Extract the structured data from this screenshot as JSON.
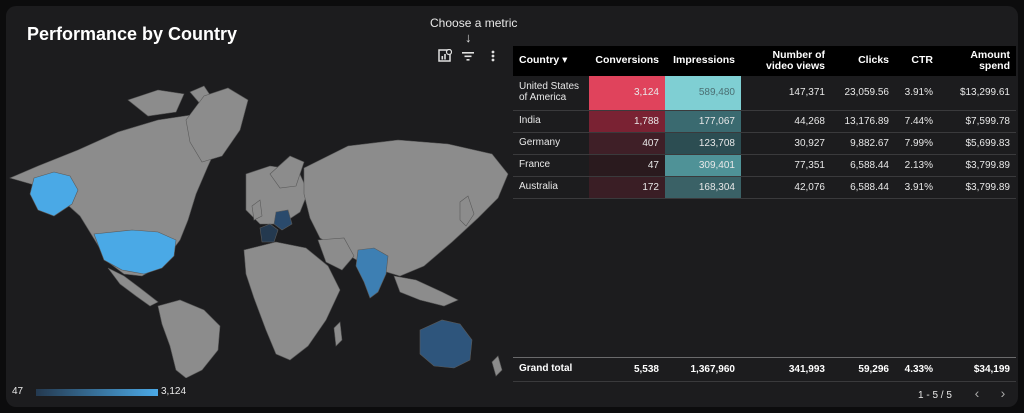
{
  "title": "Performance by Country",
  "metric_hint": "Choose a metric",
  "arrow_glyph": "↓",
  "toolbar": {
    "chart_icon": "chart-settings-icon",
    "filter_icon": "filter-icon",
    "more_icon": "more-vert-icon"
  },
  "legend": {
    "min": "47",
    "max": "3,124",
    "color_low": "#24394f",
    "color_high": "#4ba9e6"
  },
  "table": {
    "headers": [
      "Country",
      "Conversions",
      "Impressions",
      "Number of video views",
      "Clicks",
      "CTR",
      "Amount spend"
    ],
    "sort_glyph": "▾",
    "rows": [
      {
        "country": "United States of America",
        "conversions": "3,124",
        "impressions": "589,480",
        "video_views": "147,371",
        "clicks": "23,059.56",
        "ctr": "3.91%",
        "spend": "$13,299.61"
      },
      {
        "country": "India",
        "conversions": "1,788",
        "impressions": "177,067",
        "video_views": "44,268",
        "clicks": "13,176.89",
        "ctr": "7.44%",
        "spend": "$7,599.78"
      },
      {
        "country": "Germany",
        "conversions": "407",
        "impressions": "123,708",
        "video_views": "30,927",
        "clicks": "9,882.67",
        "ctr": "7.99%",
        "spend": "$5,699.83"
      },
      {
        "country": "France",
        "conversions": "47",
        "impressions": "309,401",
        "video_views": "77,351",
        "clicks": "6,588.44",
        "ctr": "2.13%",
        "spend": "$3,799.89"
      },
      {
        "country": "Australia",
        "conversions": "172",
        "impressions": "168,304",
        "video_views": "42,076",
        "clicks": "6,588.44",
        "ctr": "3.91%",
        "spend": "$3,799.89"
      }
    ],
    "conversion_colors": [
      "#e0435c",
      "#7a2233",
      "#3f1f27",
      "#2a1a1e",
      "#3a1e25"
    ],
    "impression_colors": [
      "#7fcfd3",
      "#3a6a70",
      "#2c4d52",
      "#4f9297",
      "#3a6166"
    ],
    "impression_text_colors": [
      "#4b6f73",
      "#e8e8e8",
      "#e8e8e8",
      "#e8e8e8",
      "#e8e8e8"
    ],
    "grand_total": {
      "label": "Grand total",
      "conversions": "5,538",
      "impressions": "1,367,960",
      "video_views": "341,993",
      "clicks": "59,296",
      "ctr": "4.33%",
      "spend": "$34,199"
    }
  },
  "pagination": {
    "range": "1 - 5 / 5",
    "prev_glyph": "‹",
    "next_glyph": "›"
  },
  "map_colors": {
    "land": "#8c8c8c",
    "border": "#5a5a5a",
    "usa": "#4aa9e6",
    "alaska": "#4aa9e6",
    "india": "#3d7fb3",
    "germany": "#2a4a6c",
    "france": "#24394f",
    "australia": "#2e557c"
  }
}
